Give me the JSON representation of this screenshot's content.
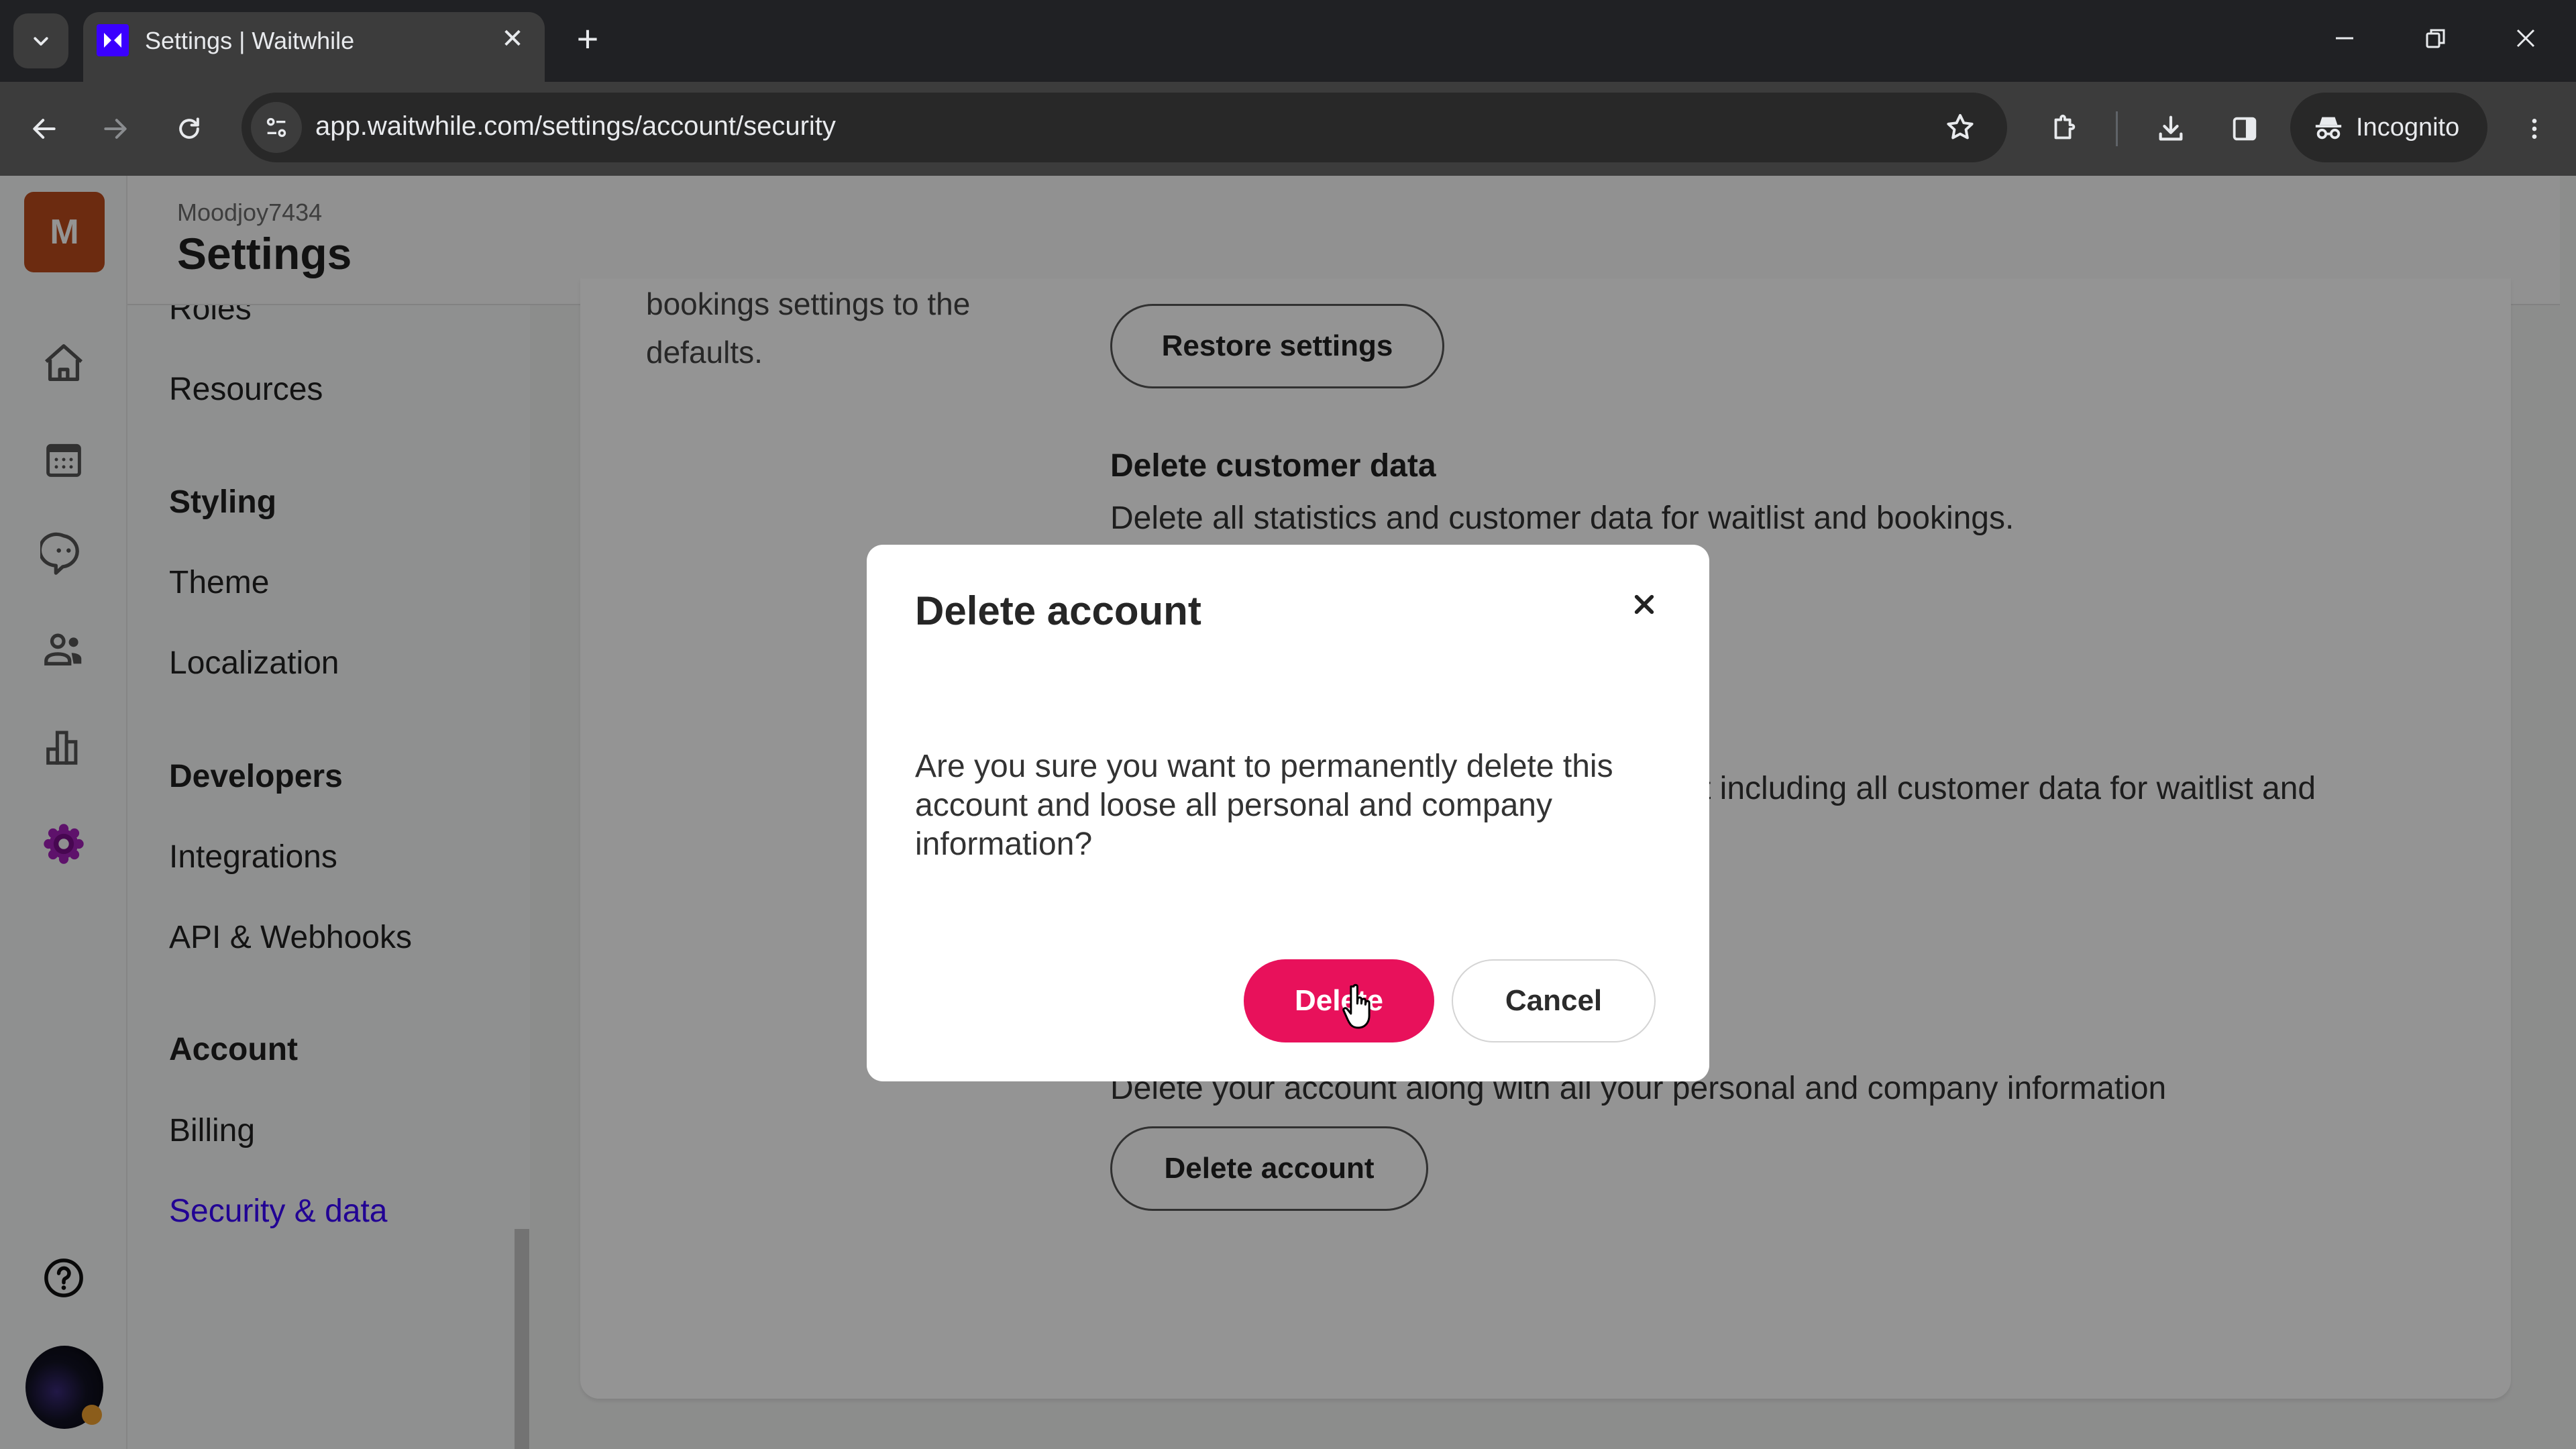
{
  "browser": {
    "tab_title": "Settings | Waitwhile",
    "url": "app.waitwhile.com/settings/account/security",
    "profile_label": "Incognito",
    "favicon_color": "#3a00ff"
  },
  "app": {
    "org_initial": "M",
    "org_name": "Moodjoy7434",
    "page_title": "Settings",
    "accent_color": "#3a00ff",
    "rail_icons": [
      "home-icon",
      "calendar-icon",
      "chat-icon",
      "users-icon",
      "analytics-icon",
      "settings-icon",
      "help-icon"
    ]
  },
  "sidebar": {
    "items": [
      {
        "type": "item",
        "label": "Roles"
      },
      {
        "type": "item",
        "label": "Resources"
      },
      {
        "type": "heading",
        "label": "Styling"
      },
      {
        "type": "item",
        "label": "Theme"
      },
      {
        "type": "item",
        "label": "Localization"
      },
      {
        "type": "heading",
        "label": "Developers"
      },
      {
        "type": "item",
        "label": "Integrations"
      },
      {
        "type": "item",
        "label": "API & Webhooks"
      },
      {
        "type": "heading",
        "label": "Account"
      },
      {
        "type": "item",
        "label": "Billing"
      },
      {
        "type": "item",
        "label": "Security & data",
        "active": true
      }
    ]
  },
  "content": {
    "restore_desc_line1": "bookings settings to the",
    "restore_desc_line2": "defaults.",
    "restore_button": "Restore settings",
    "delete_customer_title": "Delete customer data",
    "delete_customer_desc": "Delete all statistics and customer data for waitlist and bookings.",
    "delete_all_desc_partial": "t including all customer data for waitlist and",
    "delete_account_desc": "Delete your account along with all your personal and company information",
    "delete_account_button": "Delete account"
  },
  "modal": {
    "title": "Delete account",
    "body": "Are you sure you want to permanently delete this account and loose all personal and company information?",
    "confirm_label": "Delete",
    "cancel_label": "Cancel",
    "confirm_color": "#e8115b"
  }
}
